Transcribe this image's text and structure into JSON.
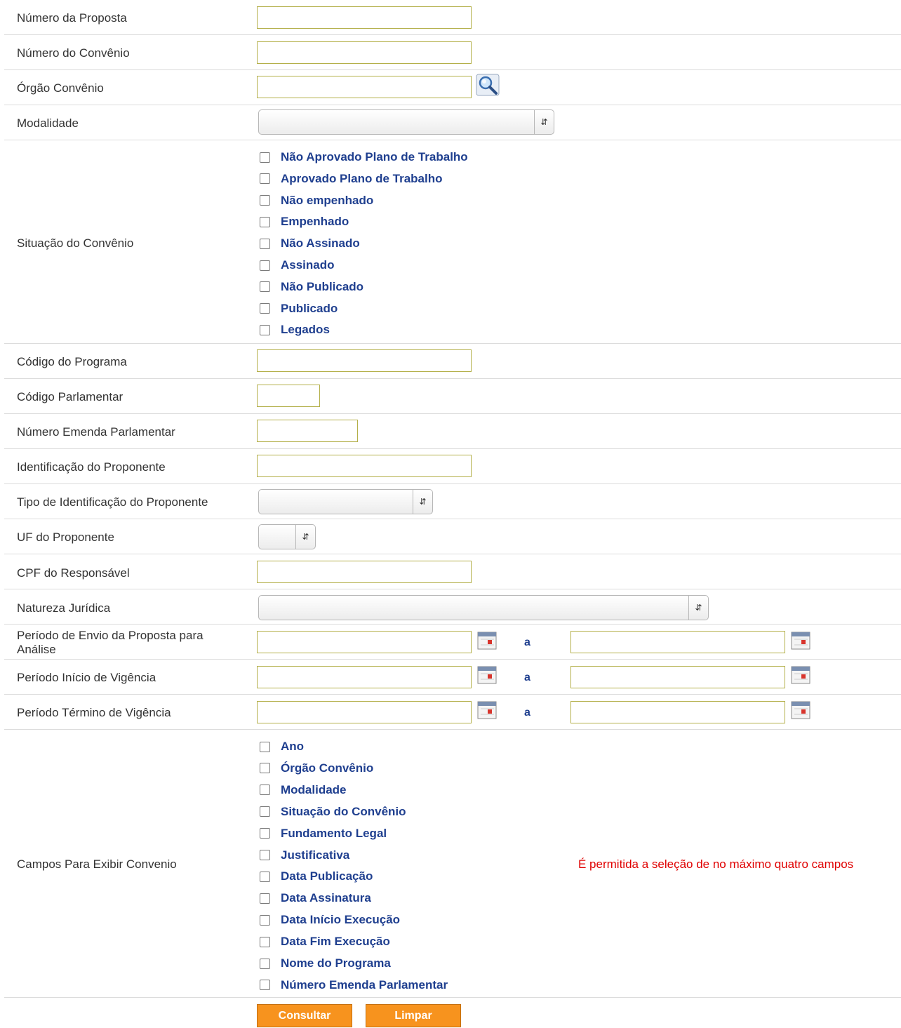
{
  "fields": {
    "numero_proposta": {
      "label": "Número da Proposta",
      "value": ""
    },
    "numero_convenio": {
      "label": "Número do Convênio",
      "value": ""
    },
    "orgao_convenio": {
      "label": "Órgão Convênio",
      "value": ""
    },
    "modalidade": {
      "label": "Modalidade",
      "selected": ""
    },
    "situacao": {
      "label": "Situação do Convênio",
      "options": [
        "Não Aprovado Plano de Trabalho",
        "Aprovado Plano de Trabalho",
        "Não empenhado",
        "Empenhado",
        "Não Assinado",
        "Assinado",
        "Não Publicado",
        "Publicado",
        "Legados"
      ]
    },
    "codigo_programa": {
      "label": "Código do Programa",
      "value": ""
    },
    "codigo_parlamentar": {
      "label": "Código Parlamentar",
      "value": ""
    },
    "numero_emenda": {
      "label": "Número Emenda Parlamentar",
      "value": ""
    },
    "identificacao_proponente": {
      "label": "Identificação do Proponente",
      "value": ""
    },
    "tipo_identificacao": {
      "label": "Tipo de Identificação do Proponente",
      "selected": ""
    },
    "uf_proponente": {
      "label": "UF do Proponente",
      "selected": ""
    },
    "cpf_responsavel": {
      "label": "CPF do Responsável",
      "value": ""
    },
    "natureza_juridica": {
      "label": "Natureza Jurídica",
      "selected": ""
    },
    "periodo_envio": {
      "label": "Período de Envio da Proposta para Análise",
      "separator": "a"
    },
    "periodo_inicio": {
      "label": "Período Início de Vigência",
      "separator": "a"
    },
    "periodo_termino": {
      "label": "Período Término de Vigência",
      "separator": "a"
    },
    "campos_exibir": {
      "label": "Campos Para Exibir Convenio",
      "options": [
        "Ano",
        "Órgão Convênio",
        "Modalidade",
        "Situação do Convênio",
        "Fundamento Legal",
        "Justificativa",
        "Data Publicação",
        "Data Assinatura",
        "Data Início Execução",
        "Data Fim Execução",
        "Nome do Programa",
        "Número Emenda Parlamentar"
      ],
      "warning": "É permitida a seleção de no máximo quatro campos"
    }
  },
  "buttons": {
    "consultar": "Consultar",
    "limpar": "Limpar"
  },
  "colors": {
    "accent": "#f7931e",
    "link": "#1f3f8f",
    "warning": "#e00000",
    "input_border": "#b4b04a"
  },
  "icons": {
    "lookup": "magnifier-icon",
    "date": "calendar-icon"
  }
}
